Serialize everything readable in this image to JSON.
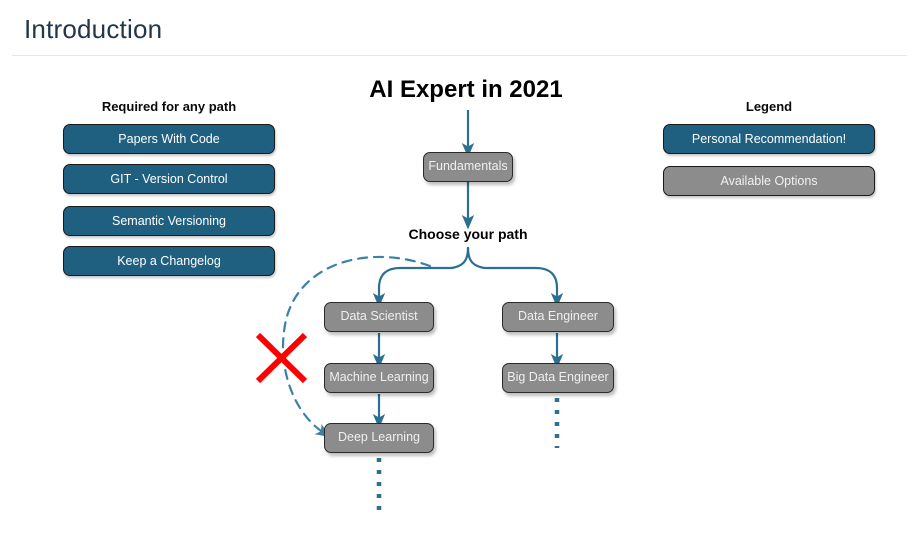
{
  "header": {
    "title": "Introduction"
  },
  "diagram": {
    "title": "AI Expert in 2021",
    "choose_path_label": "Choose your path",
    "nodes": {
      "fundamentals": "Fundamentals",
      "data_scientist": "Data Scientist",
      "machine_learning": "Machine Learning",
      "deep_learning": "Deep Learning",
      "data_engineer": "Data Engineer",
      "big_data_engineer": "Big Data Engineer"
    },
    "blocked_marker": "red-x-cross"
  },
  "required": {
    "heading": "Required for any path",
    "items": [
      {
        "label": "Papers With Code"
      },
      {
        "label": "GIT - Version Control"
      },
      {
        "label": "Semantic Versioning"
      },
      {
        "label": "Keep a Changelog"
      }
    ]
  },
  "legend": {
    "heading": "Legend",
    "items": [
      {
        "label": "Personal Recommendation!",
        "style": "teal"
      },
      {
        "label": "Available Options",
        "style": "gray"
      }
    ]
  },
  "colors": {
    "accent_teal": "#1f6080",
    "node_gray": "#8c8c8c",
    "connector_blue": "#2b6f92",
    "blocked_red": "#ff0000",
    "title_navy": "#20374c"
  }
}
